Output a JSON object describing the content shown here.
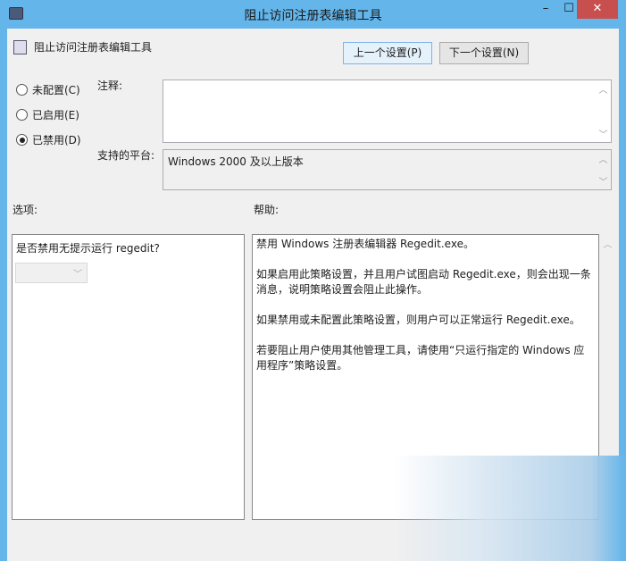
{
  "window": {
    "title": "阻止访问注册表编辑工具",
    "minimize": "–",
    "maximize": "☐",
    "close": "✕"
  },
  "header": {
    "policy_name": "阻止访问注册表编辑工具",
    "prev_button": "上一个设置(P)",
    "next_button": "下一个设置(N)"
  },
  "state": {
    "options": [
      {
        "label": "未配置(C)",
        "checked": false
      },
      {
        "label": "已启用(E)",
        "checked": false
      },
      {
        "label": "已禁用(D)",
        "checked": true
      }
    ]
  },
  "comment": {
    "label": "注释:",
    "value": ""
  },
  "platform": {
    "label": "支持的平台:",
    "value": "Windows 2000 及以上版本"
  },
  "options_panel": {
    "label": "选项:",
    "question": "是否禁用无提示运行 regedit?",
    "dropdown_value": ""
  },
  "help_panel": {
    "label": "帮助:",
    "paragraphs": [
      "禁用 Windows 注册表编辑器 Regedit.exe。",
      "如果启用此策略设置，并且用户试图启动 Regedit.exe，则会出现一条消息，说明策略设置会阻止此操作。",
      "如果禁用或未配置此策略设置，则用户可以正常运行 Regedit.exe。",
      "若要阻止用户使用其他管理工具，请使用“只运行指定的 Windows 应用程序”策略设置。"
    ]
  }
}
